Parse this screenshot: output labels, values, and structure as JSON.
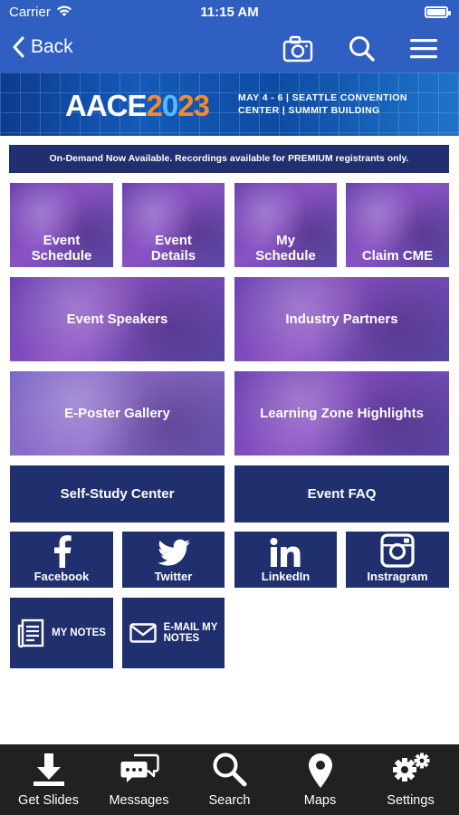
{
  "status_bar": {
    "carrier": "Carrier",
    "time": "11:15 AM"
  },
  "nav": {
    "back_label": "Back"
  },
  "banner": {
    "logo_part1": "AACE",
    "logo_part2": "2",
    "logo_part3": "0",
    "logo_part4": "23",
    "line1": "MAY 4 - 6 | SEATTLE CONVENTION",
    "line2": "CENTER | SUMMIT BUILDING"
  },
  "notice": "On-Demand Now Available. Recordings available for PREMIUM registrants only.",
  "tiles": {
    "event_schedule": {
      "line1": "Event",
      "line2": "Schedule"
    },
    "event_details": {
      "line1": "Event",
      "line2": "Details"
    },
    "my_schedule": {
      "line1": "My",
      "line2": "Schedule"
    },
    "claim_cme": "Claim CME",
    "event_speakers": "Event Speakers",
    "industry_partners": "Industry Partners",
    "eposter_gallery": "E-Poster Gallery",
    "learning_zone": "Learning Zone Highlights",
    "self_study": "Self-Study Center",
    "event_faq": "Event FAQ",
    "facebook": "Facebook",
    "twitter": "Twitter",
    "linkedin": "LinkedIn",
    "instagram": "Instragram",
    "my_notes": "MY NOTES",
    "email_notes_line1": "E-MAIL MY",
    "email_notes_line2": "NOTES"
  },
  "tabbar": {
    "get_slides": "Get Slides",
    "messages": "Messages",
    "search": "Search",
    "maps": "Maps",
    "settings": "Settings"
  },
  "colors": {
    "brand_blue": "#2f5fc1",
    "navy_tile": "#20306f",
    "tab_bar": "#212121",
    "accent_orange": "#f28a2e"
  }
}
